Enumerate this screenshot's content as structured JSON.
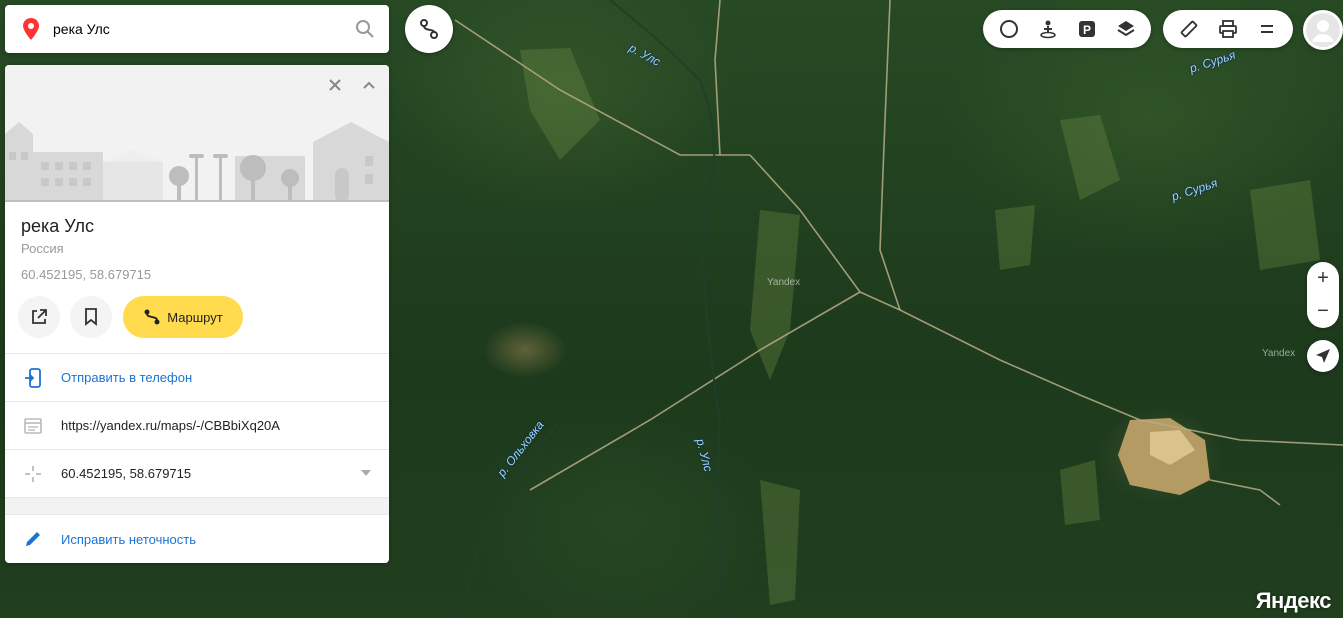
{
  "search": {
    "value": "река Улс",
    "placeholder": ""
  },
  "card": {
    "title": "река Улс",
    "country": "Россия",
    "coordinates": "60.452195, 58.679715",
    "route_label": "Маршрут",
    "send_to_phone": "Отправить в телефон",
    "url": "https://yandex.ru/maps/-/CBBbiXq20A",
    "coordinates_row": "60.452195, 58.679715",
    "fix_inaccuracy": "Исправить неточность"
  },
  "map": {
    "labels": {
      "uls_top": "р. Улс",
      "uls_middle": "р. Улс",
      "surya_top": "р. Сурья",
      "surya_mid": "р. Сурья",
      "olkhovka": "р. Ольховка"
    },
    "watermark_1": "Yandex",
    "watermark_2": "Yandex",
    "brand": "Яндекс"
  },
  "controls": {
    "zoom_in": "+",
    "zoom_out": "−"
  },
  "icons": {
    "search_pin": "location-pin-icon",
    "search": "search-icon",
    "route": "route-icon",
    "traffic": "traffic-icon",
    "panorama": "panorama-icon",
    "parking": "parking-icon",
    "layers": "layers-icon",
    "ruler": "ruler-icon",
    "print": "print-icon",
    "menu": "menu-icon",
    "avatar": "user-avatar-icon",
    "locate": "geolocation-icon"
  },
  "colors": {
    "accent_yellow": "#ffdb4d",
    "link_blue": "#1a74d6",
    "pin_red": "#f33"
  }
}
